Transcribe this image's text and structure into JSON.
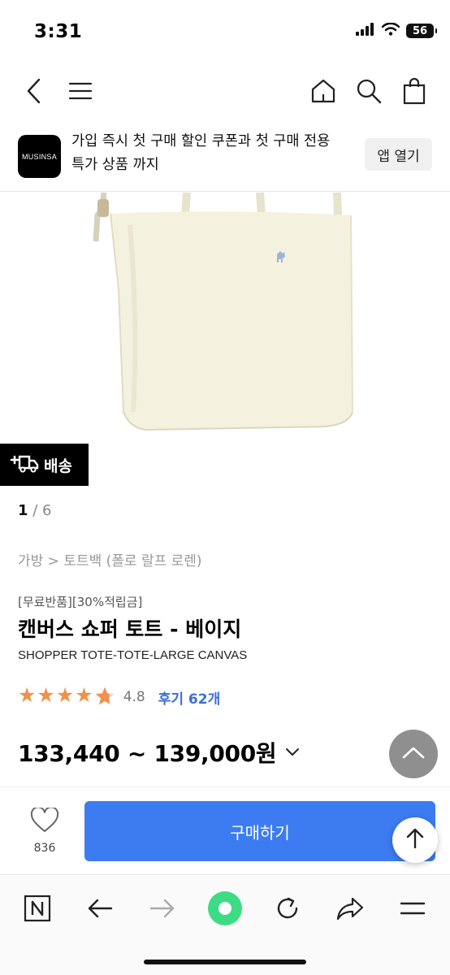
{
  "status_bar": {
    "time": "3:31",
    "battery": "56",
    "icons": [
      "signal-icon",
      "wifi-icon",
      "battery-icon"
    ]
  },
  "nav": {
    "icons": [
      "back-arrow-icon",
      "menu-icon",
      "home-icon",
      "search-icon",
      "shopping-bag-icon"
    ]
  },
  "app_banner": {
    "logo_text": "MUSINSA",
    "message_line1": "가입 즉시 첫 구매 할인 쿠폰과 첫 구매 전용",
    "message_line2": "특가 상품 까지",
    "open_app_label": "앱 열기"
  },
  "delivery_badge": {
    "label": "배송",
    "icon": "truck-plus-icon"
  },
  "pager": {
    "current": "1",
    "separator": " / ",
    "total": "6"
  },
  "product": {
    "breadcrumb": "가방 > 토트백 (폴로 랄프 로렌)",
    "tags": "[무료반품][30%적립금]",
    "title": "캔버스 쇼퍼 토트 - 베이지",
    "subtitle": "SHOPPER TOTE-TOTE-LARGE CANVAS",
    "rating": "4.8",
    "rating_stars": 4.8,
    "review_label": "후기 62개",
    "price_range": "133,440 ~ 139,000원"
  },
  "bottom_action": {
    "like_count": "836",
    "buy_label": "구매하기"
  },
  "colors": {
    "accent_blue": "#3c7cf0",
    "star_orange": "#f0924b",
    "review_blue": "#3a6fd8",
    "bag_cream": "#f4f1df",
    "browser_green": "#3ddc84"
  },
  "browser_bar": {
    "icons": [
      "naver-n-icon",
      "back-icon",
      "forward-icon",
      "green-dot-icon",
      "refresh-icon",
      "share-icon",
      "menu-icon"
    ]
  }
}
